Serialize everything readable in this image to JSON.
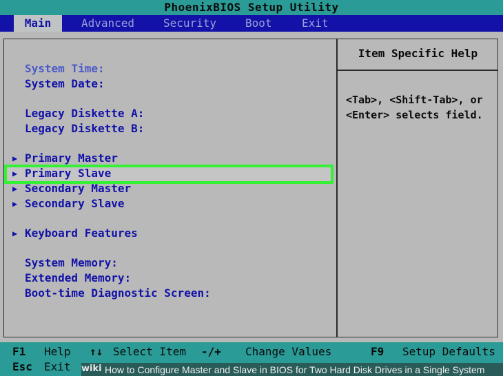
{
  "title": "PhoenixBIOS Setup Utility",
  "menu": [
    "Main",
    "Advanced",
    "Security",
    "Boot",
    "Exit"
  ],
  "active_menu": "Main",
  "fields": [
    {
      "label": "System Time:",
      "dim": true
    },
    {
      "label": "System Date:",
      "dim": false
    },
    {
      "label": "Legacy Diskette A:",
      "dim": false
    },
    {
      "label": "Legacy Diskette B:",
      "dim": false
    },
    {
      "label": "Primary Master",
      "dim": false,
      "submenu": true
    },
    {
      "label": "Primary Slave",
      "dim": false,
      "submenu": true,
      "selected": true
    },
    {
      "label": "Secondary Master",
      "dim": false,
      "submenu": true
    },
    {
      "label": "Secondary Slave",
      "dim": false,
      "submenu": true
    },
    {
      "label": "Keyboard Features",
      "dim": false,
      "submenu": true
    },
    {
      "label": "System Memory:",
      "dim": false
    },
    {
      "label": "Extended Memory:",
      "dim": false
    },
    {
      "label": "Boot-time Diagnostic Screen:",
      "dim": false
    }
  ],
  "help": {
    "title": "Item Specific Help",
    "text": "<Tab>, <Shift-Tab>, or <Enter> selects field."
  },
  "footer": [
    {
      "key": "F1",
      "desc": "Help"
    },
    {
      "key": "↑↓",
      "desc": "Select Item"
    },
    {
      "key": "-/+",
      "desc": "Change Values"
    },
    {
      "key": "F9",
      "desc": "Setup Defaults"
    },
    {
      "key": "Esc",
      "desc": "Exit"
    }
  ],
  "watermark": {
    "logo": "wiki",
    "text": "How to Configure Master and Slave in BIOS for Two Hard Disk Drives in a Single System"
  },
  "colors": {
    "menu_bg": "#1212a8",
    "panel_bg": "#b9b9b9",
    "title_bg": "#2a9b96",
    "highlight": "#35f135",
    "field_text": "#1212a8"
  }
}
